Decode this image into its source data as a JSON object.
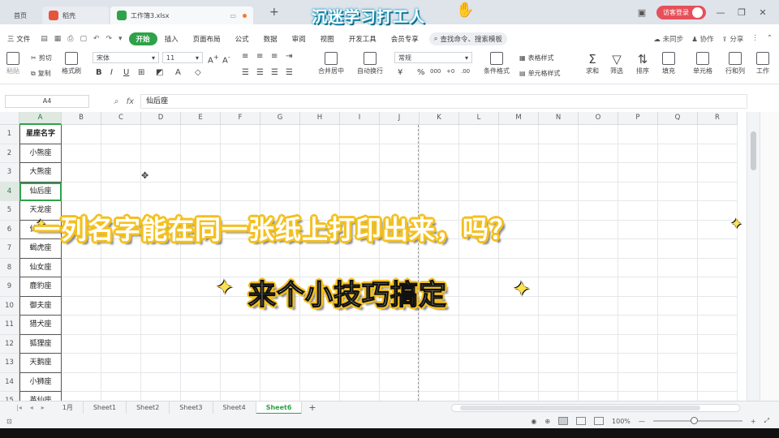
{
  "titlebar": {
    "tabs": [
      {
        "label": "首页"
      },
      {
        "label": "稻壳"
      },
      {
        "label": "工作簿3.xlsx"
      }
    ],
    "new_tab": "+",
    "login_label": "访客登录",
    "overlay_title": "沉迷学习打工人"
  },
  "menubar": {
    "file_label": "三 文件",
    "items": [
      "开始",
      "插入",
      "页面布局",
      "公式",
      "数据",
      "审阅",
      "视图",
      "开发工具",
      "会员专享"
    ],
    "search_placeholder": "查找命令、搜索模板",
    "right_items": [
      "未同步",
      "协作",
      "分享"
    ]
  },
  "ribbon": {
    "paste": "粘贴",
    "cut": "剪切",
    "copy": "复制",
    "format_painter": "格式刷",
    "font_name": "宋体",
    "font_size": "11",
    "merge_center": "合并居中",
    "auto_wrap": "自动换行",
    "number_format": "常规",
    "conditional_format": "条件格式",
    "table_style": "表格样式",
    "cell_style": "单元格样式",
    "sum": "求和",
    "filter": "筛选",
    "sort": "排序",
    "fill": "填充",
    "cell": "单元格",
    "row_col": "行和列",
    "worksheet": "工作"
  },
  "formula_bar": {
    "cell_ref": "A4",
    "fx": "fx",
    "value": "仙后座"
  },
  "sheet": {
    "columns": [
      "A",
      "B",
      "C",
      "D",
      "E",
      "F",
      "G",
      "H",
      "I",
      "J",
      "K",
      "L",
      "M",
      "N",
      "O",
      "P",
      "Q",
      "R"
    ],
    "rows": [
      "1",
      "2",
      "3",
      "4",
      "5",
      "6",
      "7",
      "8",
      "9",
      "10",
      "11",
      "12",
      "13",
      "14",
      "15"
    ],
    "col_a_values": [
      "星座名字",
      "小熊座",
      "大熊座",
      "仙后座",
      "天龙座",
      "仙王座",
      "蝎虎座",
      "仙女座",
      "鹿豹座",
      "御夫座",
      "猎犬座",
      "狐狸座",
      "天鹅座",
      "小狮座",
      "英仙座"
    ],
    "active_cell": "A4"
  },
  "sheet_tabs": {
    "tabs": [
      "1月",
      "Sheet1",
      "Sheet2",
      "Sheet3",
      "Sheet4",
      "Sheet6"
    ],
    "active": "Sheet6",
    "add": "+"
  },
  "statusbar": {
    "zoom": "100%"
  },
  "captions": {
    "line1": "一列名字能在同一张纸上打印出来，吗？",
    "line2": "来个小技巧搞定"
  },
  "colors": {
    "accent_green": "#2ea24a",
    "caption_outline": "#f4c01e",
    "login_red": "#e6505a"
  }
}
